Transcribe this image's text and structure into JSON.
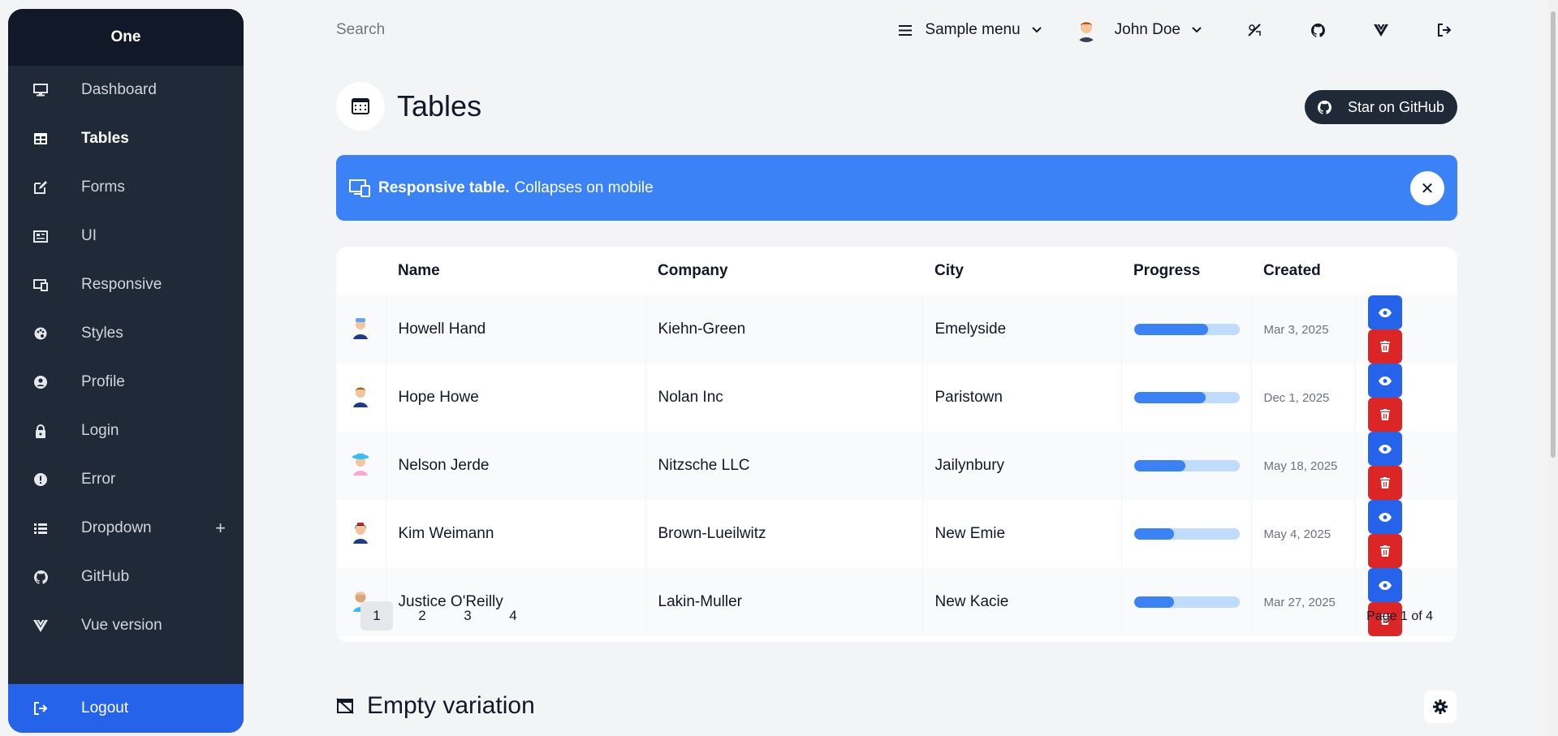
{
  "sidebar": {
    "brand": "One",
    "items": [
      {
        "label": "Dashboard"
      },
      {
        "label": "Tables"
      },
      {
        "label": "Forms"
      },
      {
        "label": "UI"
      },
      {
        "label": "Responsive"
      },
      {
        "label": "Styles"
      },
      {
        "label": "Profile"
      },
      {
        "label": "Login"
      },
      {
        "label": "Error"
      },
      {
        "label": "Dropdown",
        "expand": "+"
      },
      {
        "label": "GitHub"
      },
      {
        "label": "Vue version"
      }
    ],
    "logout": "Logout"
  },
  "topbar": {
    "search_placeholder": "Search",
    "menu_label": "Sample menu",
    "user_name": "John Doe"
  },
  "header": {
    "title": "Tables",
    "star_button": "Star on GitHub"
  },
  "alert": {
    "strong": "Responsive table.",
    "text": "Collapses on mobile",
    "close": "✕"
  },
  "table": {
    "columns": [
      "Name",
      "Company",
      "City",
      "Progress",
      "Created"
    ],
    "rows": [
      {
        "name": "Howell Hand",
        "company": "Kiehn-Green",
        "city": "Emelyside",
        "progress": 70,
        "created": "Mar 3, 2025"
      },
      {
        "name": "Hope Howe",
        "company": "Nolan Inc",
        "city": "Paristown",
        "progress": 68,
        "created": "Dec 1, 2025"
      },
      {
        "name": "Nelson Jerde",
        "company": "Nitzsche LLC",
        "city": "Jailynbury",
        "progress": 49,
        "created": "May 18, 2025"
      },
      {
        "name": "Kim Weimann",
        "company": "Brown-Lueilwitz",
        "city": "New Emie",
        "progress": 38,
        "created": "May 4, 2025"
      },
      {
        "name": "Justice O'Reilly",
        "company": "Lakin-Muller",
        "city": "New Kacie",
        "progress": 38,
        "created": "Mar 27, 2025"
      }
    ],
    "pages": [
      "1",
      "2",
      "3",
      "4"
    ],
    "page_info": "Page 1 of 4"
  },
  "empty_section": {
    "title": "Empty variation"
  },
  "colors": {
    "sidebar_bg": "#1f2937",
    "accent": "#3b82f6",
    "view_button": "#2563eb",
    "delete_button": "#dc2626"
  }
}
